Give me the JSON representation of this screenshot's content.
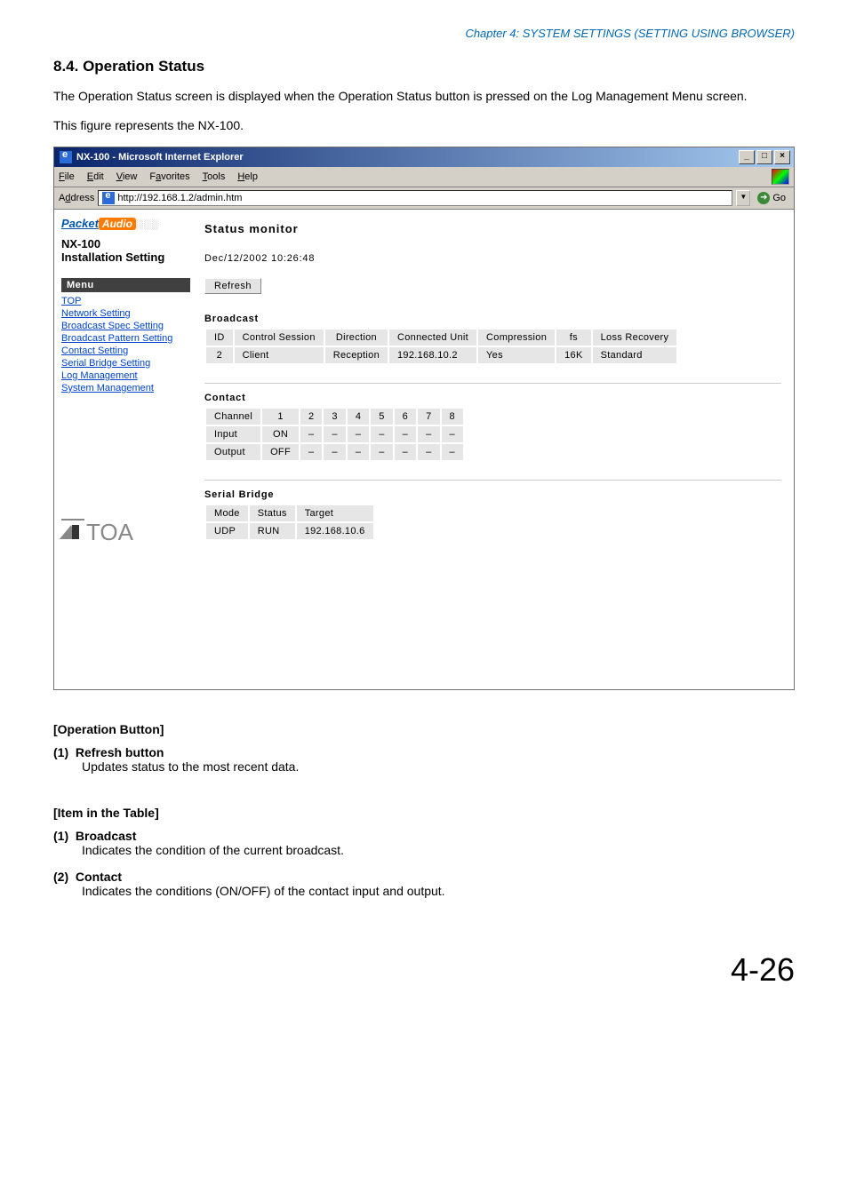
{
  "chapter": "Chapter 4:  SYSTEM SETTINGS (SETTING USING BROWSER)",
  "section_title": "8.4. Operation Status",
  "para1": "The Operation Status screen is displayed when the Operation Status button is pressed on the Log Management Menu screen.",
  "para2": "This figure represents the NX-100.",
  "browser": {
    "title": "NX-100 - Microsoft Internet Explorer",
    "controls": {
      "min": "_",
      "max": "□",
      "close": "×"
    },
    "menu": [
      "File",
      "Edit",
      "View",
      "Favorites",
      "Tools",
      "Help"
    ],
    "address_label": "Address",
    "address_value": "http://192.168.1.2/admin.htm",
    "go": "Go"
  },
  "sidebar": {
    "brand_packet": "Packet",
    "brand_audio": "Audio",
    "nx": "NX-100",
    "install": "Installation Setting",
    "menu_header": "Menu",
    "links": [
      "TOP",
      "Network Setting",
      "Broadcast Spec Setting",
      "Broadcast Pattern Setting",
      "Contact Setting",
      "Serial Bridge Setting",
      "Log Management",
      "System Management"
    ],
    "toa": "TOA"
  },
  "main": {
    "status_title": "Status monitor",
    "timestamp": "Dec/12/2002 10:26:48",
    "refresh": "Refresh",
    "broadcast": {
      "label": "Broadcast",
      "headers": [
        "ID",
        "Control Session",
        "Direction",
        "Connected Unit",
        "Compression",
        "fs",
        "Loss Recovery"
      ],
      "row": [
        "2",
        "Client",
        "Reception",
        "192.168.10.2",
        "Yes",
        "16K",
        "Standard"
      ]
    },
    "contact": {
      "label": "Contact",
      "channel": "Channel",
      "input": "Input",
      "output": "Output",
      "cols": [
        "1",
        "2",
        "3",
        "4",
        "5",
        "6",
        "7",
        "8"
      ],
      "in_row": [
        "ON",
        "–",
        "–",
        "–",
        "–",
        "–",
        "–",
        "–"
      ],
      "out_row": [
        "OFF",
        "–",
        "–",
        "–",
        "–",
        "–",
        "–",
        "–"
      ]
    },
    "serial": {
      "label": "Serial Bridge",
      "headers": [
        "Mode",
        "Status",
        "Target"
      ],
      "row": [
        "UDP",
        "RUN",
        "192.168.10.6"
      ]
    }
  },
  "doc": {
    "op_button_head": "[Operation Button]",
    "op1_num": "(1)",
    "op1_title": "Refresh button",
    "op1_desc": "Updates status to the most recent data.",
    "table_head": "[Item in the Table]",
    "tb1_num": "(1)",
    "tb1_title": "Broadcast",
    "tb1_desc": "Indicates the condition of the current broadcast.",
    "tb2_num": "(2)",
    "tb2_title": "Contact",
    "tb2_desc": "Indicates the conditions (ON/OFF) of the contact input and output.",
    "page_num": "4-26"
  }
}
